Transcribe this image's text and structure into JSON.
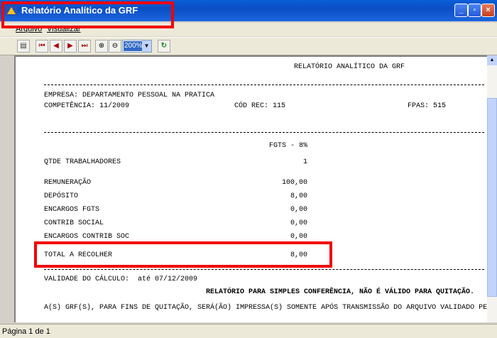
{
  "window": {
    "title": "Relatório Analítico da GRF",
    "minimize": "_",
    "maximize": "▫",
    "close": "×"
  },
  "menu": {
    "items": [
      "Arquivo",
      "Visualizar"
    ]
  },
  "toolbar": {
    "zoom_value": "200%"
  },
  "report": {
    "heading": "RELATÓRIO ANALÍTICO DA GRF",
    "empresa": "EMPRESA: DEPARTAMENTO PESSOAL NA PRATICA",
    "competencia": "COMPETÊNCIA: 11/2009",
    "cod_rec": "CÓD REC: 115",
    "fpas": "FPAS: 515",
    "fgts": "FGTS - 8%",
    "rows": [
      {
        "label": "QTDE TRABALHADORES",
        "value": "1"
      },
      {
        "label": "REMUNERAÇÃO",
        "value": "100,00"
      },
      {
        "label": "DEPÓSITO",
        "value": "8,00"
      },
      {
        "label": "ENCARGOS FGTS",
        "value": "0,00"
      },
      {
        "label": "CONTRIB SOCIAL",
        "value": "0,00"
      },
      {
        "label": "ENCARGOS CONTRIB SOC",
        "value": "0,00"
      },
      {
        "label": "TOTAL A RECOLHER",
        "value": "8,00"
      }
    ],
    "validade": "VALIDADE DO CÁLCULO:  até 07/12/2009",
    "aviso": "RELATÓRIO PARA SIMPLES CONFERÊNCIA, NÃO É VÁLIDO PARA QUITAÇÃO.",
    "nota": "A(S) GRF(S), PARA FINS DE QUITAÇÃO, SERÁ(ÃO) IMPRESSA(S) SOMENTE APÓS TRANSMISSÃO DO ARQUIVO VALIDADO PE"
  },
  "status": {
    "page": "Página 1 de 1"
  },
  "colors": {
    "title_bar": "#0b4ec4",
    "highlight": "#f20000"
  }
}
